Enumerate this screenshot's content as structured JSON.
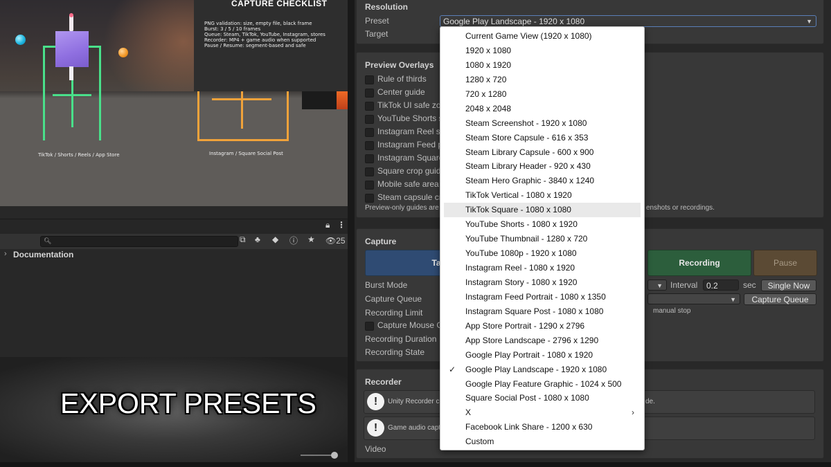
{
  "scene": {
    "left_caption": "TikTok / Shorts / Reels / App Store",
    "right_caption": "Instagram / Square Social Post",
    "checklist": {
      "title": "CAPTURE CHECKLIST",
      "lines": [
        "PNG validation: size, empty file, black frame",
        "Burst: 3 / 5 / 10 frames",
        "Queue: Steam, TikTok, YouTube, Instagram, stores",
        "Recorder: MP4 + game audio when supported",
        "Pause / Resume: segment-based and safe"
      ]
    },
    "colors": {
      "mobile_frame": "#49e08a",
      "square_frame": "#f0a23a",
      "cube": "#9a78e6"
    }
  },
  "project": {
    "search_placeholder": "",
    "visible_count": "25",
    "tree_item": "Documentation"
  },
  "overlay_title": "EXPORT PRESETS",
  "inspector": {
    "resolution": {
      "title": "Resolution",
      "preset_label": "Preset",
      "preset_value": "Google Play Landscape - 1920 x 1080",
      "target_label": "Target"
    },
    "overlays": {
      "title": "Preview Overlays",
      "items": [
        "Rule of thirds",
        "Center guide",
        "TikTok UI safe zo",
        "YouTube Shorts s",
        "Instagram Reel s",
        "Instagram Feed p",
        "Instagram Square",
        "Square crop guid",
        "Mobile safe area",
        "Steam capsule cr"
      ],
      "note_start": "Preview-only guides are",
      "note_end": "enshots or recordings."
    },
    "capture": {
      "title": "Capture",
      "take_button": "Ta",
      "recording_button": "Recording",
      "pause_button": "Pause",
      "burst_label": "Burst Mode",
      "interval_label": "Interval",
      "interval_value": "0.2",
      "interval_unit": "sec",
      "single_now": "Single Now",
      "queue_label": "Capture Queue",
      "queue_button": "Capture Queue",
      "limit_label": "Recording Limit",
      "manual_stop": "manual stop",
      "mouse_label": "Capture Mouse C",
      "duration_label": "Recording Duration",
      "state_label": "Recording State",
      "colors": {
        "take": "#2f4b73",
        "recording": "#2c5e3c",
        "pause": "#5b4a34"
      }
    },
    "recorder": {
      "title": "Recorder",
      "help1_start": "Unity Recorder c",
      "help1_end": "de.",
      "help2_start": "Game audio capt",
      "video_label": "Video"
    }
  },
  "menu": {
    "selected": "Google Play Landscape - 1920 x 1080",
    "hovered": "TikTok Square - 1080 x 1080",
    "items": [
      "Current Game View (1920 x 1080)",
      "1920 x 1080",
      "1080 x 1920",
      "1280 x 720",
      "720 x 1280",
      "2048 x 2048",
      "Steam Screenshot - 1920 x 1080",
      "Steam Store Capsule - 616 x 353",
      "Steam Library Capsule - 600 x 900",
      "Steam Library Header - 920 x 430",
      "Steam Hero Graphic - 3840 x 1240",
      "TikTok Vertical - 1080 x 1920",
      "TikTok Square - 1080 x 1080",
      "YouTube Shorts - 1080 x 1920",
      "YouTube Thumbnail - 1280 x 720",
      "YouTube 1080p - 1920 x 1080",
      "Instagram Reel - 1080 x 1920",
      "Instagram Story - 1080 x 1920",
      "Instagram Feed Portrait - 1080 x 1350",
      "Instagram Square Post - 1080 x 1080",
      "App Store Portrait - 1290 x 2796",
      "App Store Landscape - 2796 x 1290",
      "Google Play Portrait - 1080 x 1920",
      "Google Play Landscape - 1920 x 1080",
      "Google Play Feature Graphic - 1024 x 500",
      "Square Social Post - 1080 x 1080",
      "X",
      "Facebook Link Share - 1200 x 630",
      "Custom"
    ],
    "submenu_item": "X"
  }
}
